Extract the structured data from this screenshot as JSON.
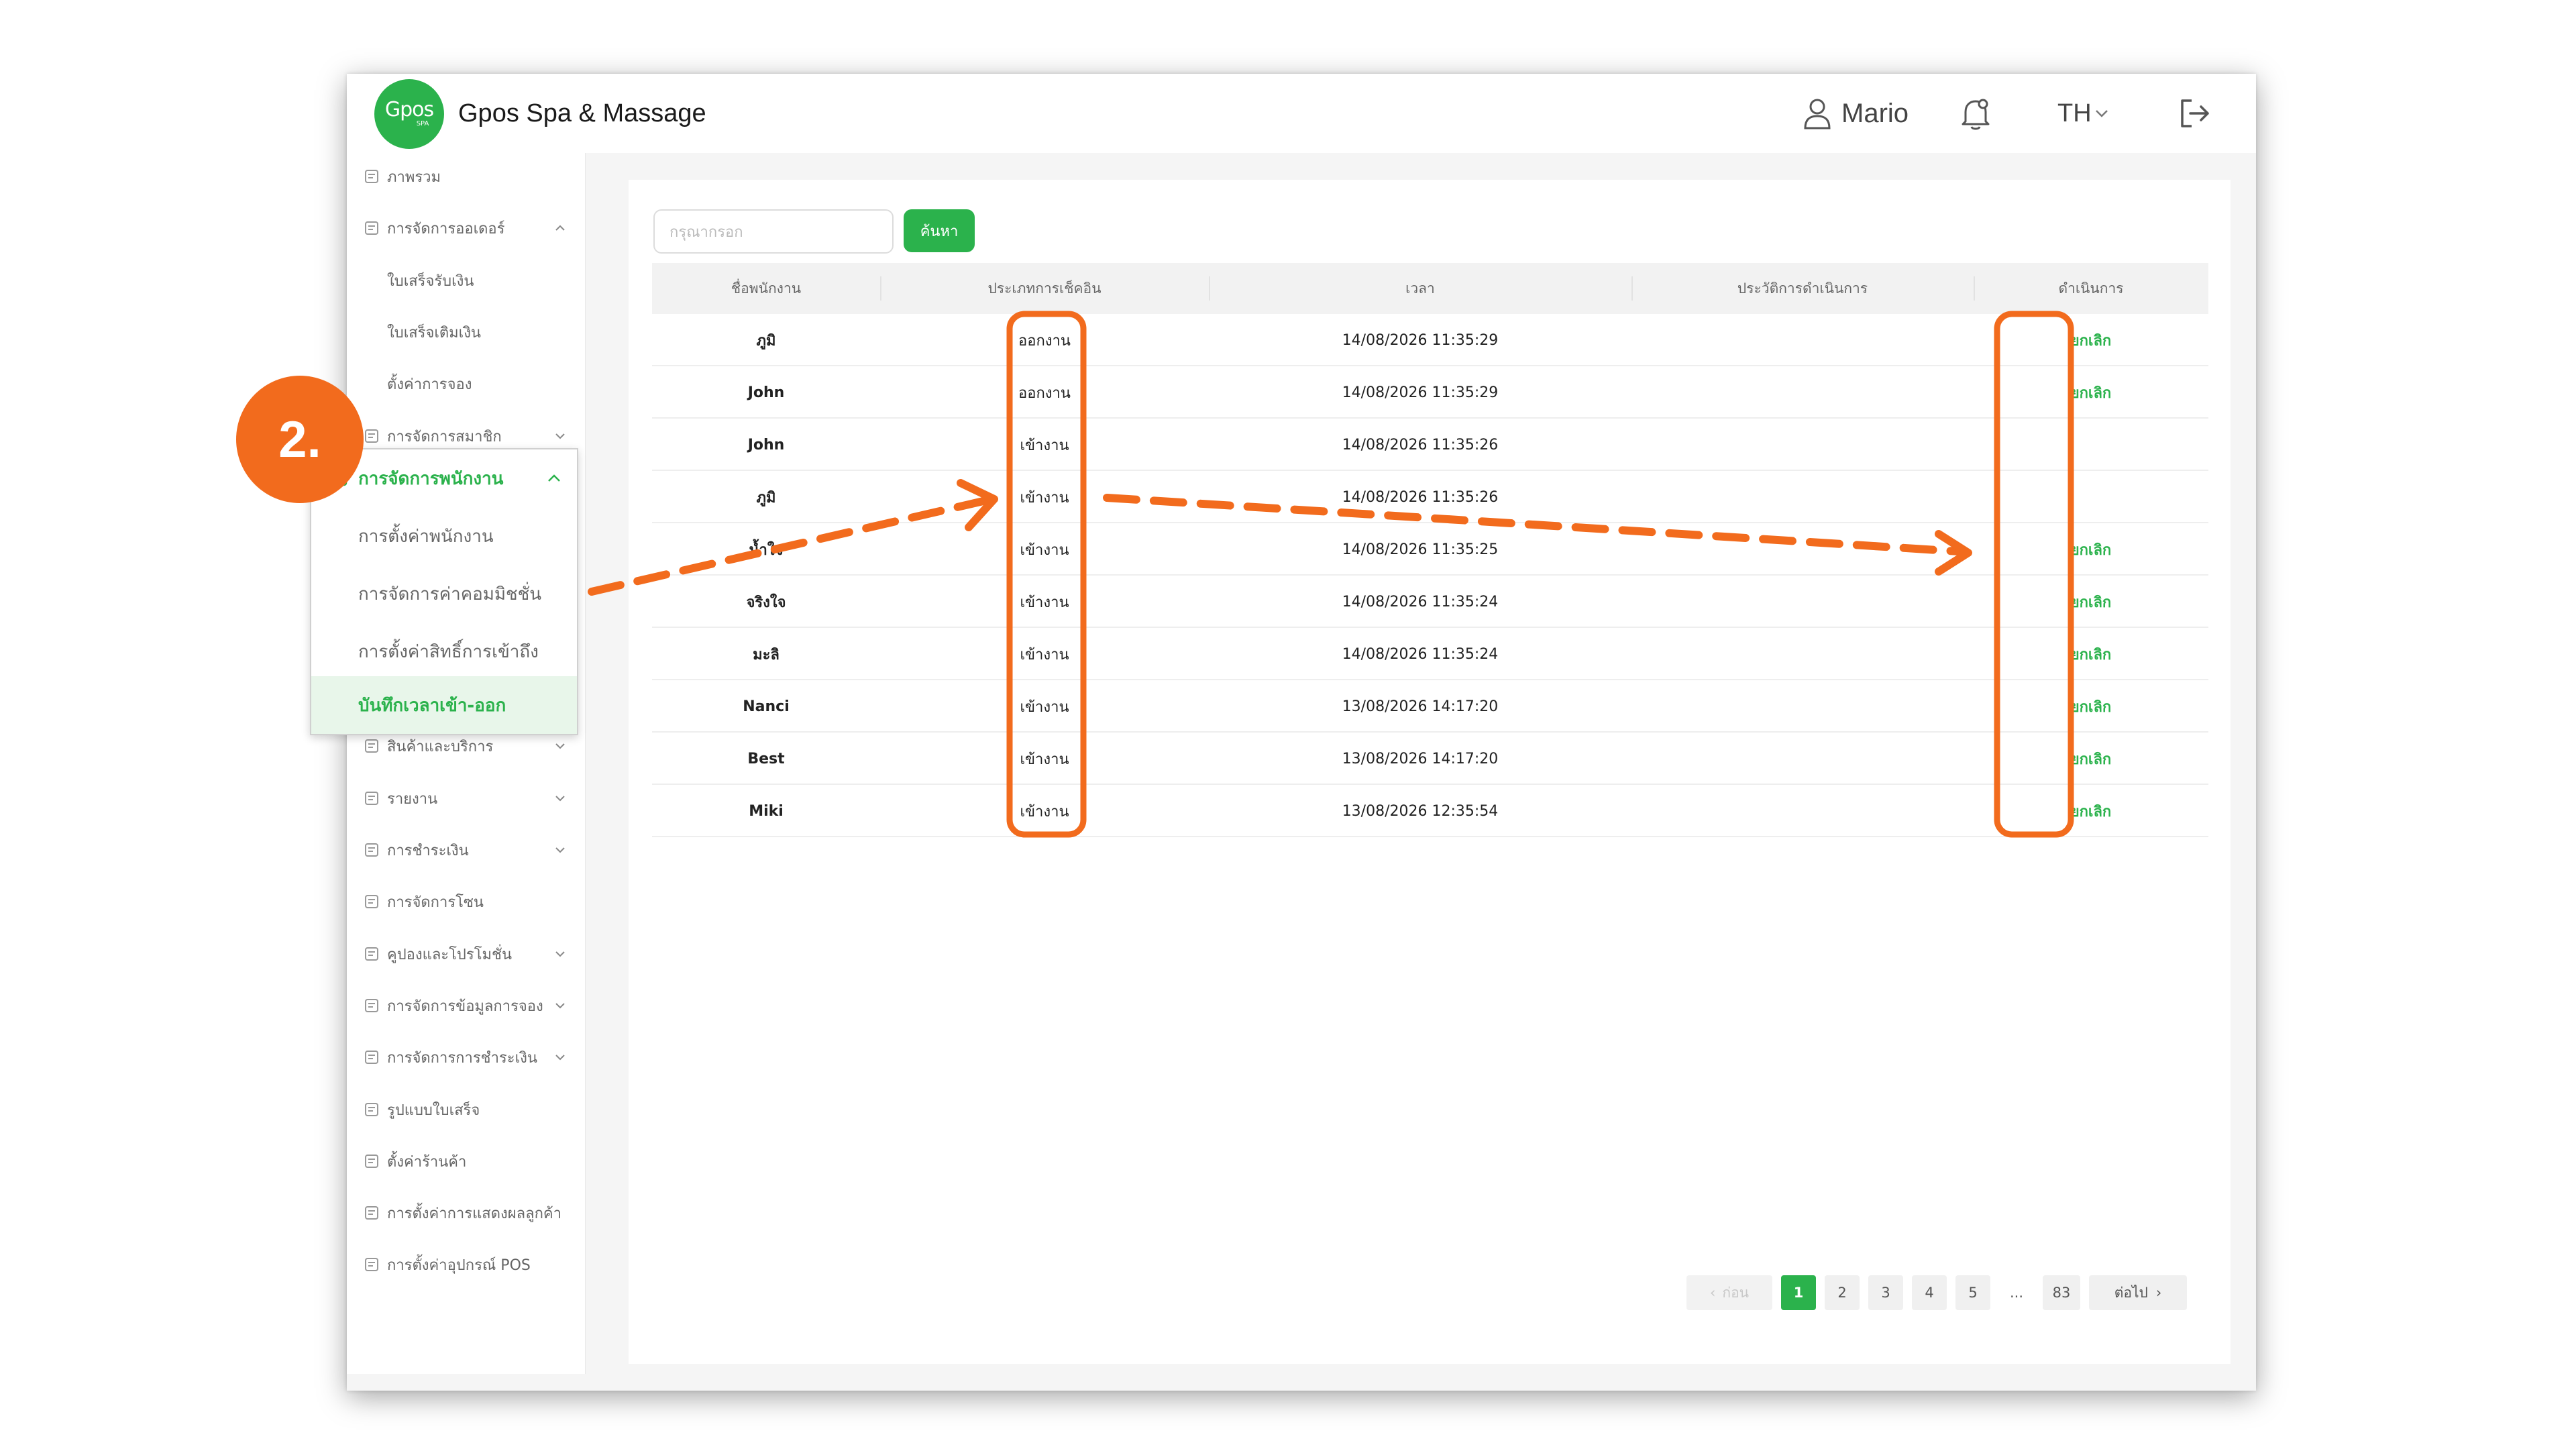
{
  "header": {
    "logo_main": "Gpos",
    "logo_sub": "SPA",
    "title": "Gpos Spa & Massage",
    "user_name": "Mario",
    "language": "TH",
    "icons": [
      "user-icon",
      "bell-icon",
      "chevron-down-icon",
      "logout-icon"
    ]
  },
  "sidebar": {
    "items": [
      {
        "label": "ภาพรวม",
        "icon": "overview-icon"
      },
      {
        "label": "การจัดการออเดอร์",
        "icon": "order-icon",
        "chevron": "up"
      },
      {
        "label": "ใบเสร็จรับเงิน",
        "sub": true
      },
      {
        "label": "ใบเสร็จเติมเงิน",
        "sub": true
      },
      {
        "label": "ตั้งค่าการจอง",
        "sub": true
      },
      {
        "label": "การจัดการสมาชิก",
        "icon": "member-icon",
        "chevron": "down"
      },
      {
        "label": "สินค้าและบริการ",
        "icon": "product-icon",
        "chevron": "down"
      },
      {
        "label": "รายงาน",
        "icon": "report-icon",
        "chevron": "down"
      },
      {
        "label": "การชำระเงิน",
        "icon": "payment-icon",
        "chevron": "down"
      },
      {
        "label": "การจัดการโซน",
        "icon": "zone-icon"
      },
      {
        "label": "คูปองและโปรโมชั่น",
        "icon": "coupon-icon",
        "chevron": "down"
      },
      {
        "label": "การจัดการข้อมูลการจอง",
        "icon": "booking-icon",
        "chevron": "down"
      },
      {
        "label": "การจัดการการชำระเงิน",
        "icon": "payment-manage-icon",
        "chevron": "down"
      },
      {
        "label": "รูปแบบใบเสร็จ",
        "icon": "receipt-icon"
      },
      {
        "label": "ตั้งค่าร้านค้า",
        "icon": "store-icon"
      },
      {
        "label": "การตั้งค่าการแสดงผลลูกค้า",
        "icon": "display-icon"
      },
      {
        "label": "การตั้งค่าอุปกรณ์ POS",
        "icon": "pos-icon"
      }
    ]
  },
  "popup": {
    "header": "การจัดการพนักงาน",
    "items": [
      "การตั้งค่าพนักงาน",
      "การจัดการค่าคอมมิชชั่น",
      "การตั้งค่าสิทธิ์การเข้าถึง",
      "บันทึกเวลาเข้า-ออก"
    ],
    "active_index": 3
  },
  "badge": "2.",
  "search": {
    "placeholder": "กรุณากรอก",
    "button": "ค้นหา"
  },
  "table": {
    "columns": [
      "ชื่อพนักงาน",
      "ประเภทการเช็คอิน",
      "เวลา",
      "ประวัติการดำเนินการ",
      "ดำเนินการ"
    ],
    "rows": [
      {
        "name": "ภูมิ",
        "type": "ออกงาน",
        "time": "14/08/2026 11:35:29",
        "history": "",
        "action": "ยกเลิก"
      },
      {
        "name": "John",
        "type": "ออกงาน",
        "time": "14/08/2026 11:35:29",
        "history": "",
        "action": "ยกเลิก"
      },
      {
        "name": "John",
        "type": "เข้างาน",
        "time": "14/08/2026 11:35:26",
        "history": "",
        "action": ""
      },
      {
        "name": "ภูมิ",
        "type": "เข้างาน",
        "time": "14/08/2026 11:35:26",
        "history": "",
        "action": ""
      },
      {
        "name": "น้ำใจ",
        "type": "เข้างาน",
        "time": "14/08/2026 11:35:25",
        "history": "",
        "action": "ยกเลิก"
      },
      {
        "name": "จริงใจ",
        "type": "เข้างาน",
        "time": "14/08/2026 11:35:24",
        "history": "",
        "action": "ยกเลิก"
      },
      {
        "name": "มะลิ",
        "type": "เข้างาน",
        "time": "14/08/2026 11:35:24",
        "history": "",
        "action": "ยกเลิก"
      },
      {
        "name": "Nanci",
        "type": "เข้างาน",
        "time": "13/08/2026 14:17:20",
        "history": "",
        "action": "ยกเลิก"
      },
      {
        "name": "Best",
        "type": "เข้างาน",
        "time": "13/08/2026 14:17:20",
        "history": "",
        "action": "ยกเลิก"
      },
      {
        "name": "Miki",
        "type": "เข้างาน",
        "time": "13/08/2026 12:35:54",
        "history": "",
        "action": "ยกเลิก"
      }
    ]
  },
  "pagination": {
    "prev": "ก่อน",
    "pages": [
      "1",
      "2",
      "3",
      "4",
      "5",
      "...",
      "83"
    ],
    "current": "1",
    "next": "ต่อไป"
  },
  "colors": {
    "accent": "#2bb24c",
    "annotation": "#f26b1d"
  }
}
